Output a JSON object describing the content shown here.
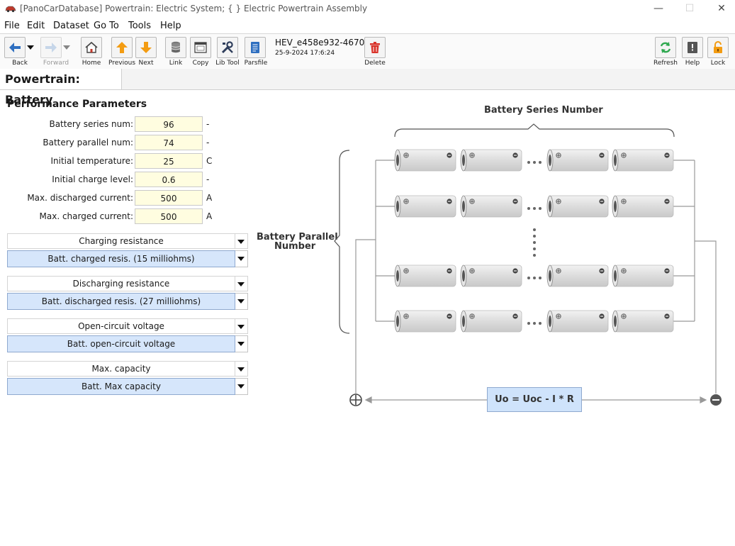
{
  "window": {
    "title": "[PanoCarDatabase] Powertrain: Electric System; {  } Electric Powertrain Assembly",
    "minimize_glyph": "—",
    "maximize_glyph": "☐",
    "close_glyph": "✕"
  },
  "menu": [
    "File",
    "Edit",
    "Dataset",
    "Go To",
    "Tools",
    "Help"
  ],
  "toolbar": {
    "back": "Back",
    "forward": "Forward",
    "home": "Home",
    "previous": "Previous",
    "next": "Next",
    "link": "Link",
    "copy": "Copy",
    "lib_tool": "Lib Tool",
    "parsfile": "Parsfile",
    "delete": "Delete",
    "refresh": "Refresh",
    "help": "Help",
    "lock": "Lock",
    "record_id": "HEV_e458e932-4670",
    "record_date": "25-9-2024 17:6:24"
  },
  "tab": {
    "title": "Powertrain: Battery"
  },
  "performance": {
    "title": "Performance Parameters",
    "params": [
      {
        "label": "Battery series num:",
        "value": "96",
        "unit": "-"
      },
      {
        "label": "Battery parallel num:",
        "value": "74",
        "unit": "-"
      },
      {
        "label": "Initial temperature:",
        "value": "25",
        "unit": "C"
      },
      {
        "label": "Initial charge level:",
        "value": "0.6",
        "unit": "-"
      },
      {
        "label": "Max. discharged current:",
        "value": "500",
        "unit": "A"
      },
      {
        "label": "Max. charged current:",
        "value": "500",
        "unit": "A"
      }
    ],
    "dropdowns": [
      {
        "header": "Charging resistance",
        "value": "Batt. charged resis. (15 milliohms)"
      },
      {
        "header": "Discharging resistance",
        "value": "Batt. discharged resis. (27 milliohms)"
      },
      {
        "header": "Open-circuit voltage",
        "value": "Batt. open-circuit voltage"
      },
      {
        "header": "Max. capacity",
        "value": "Batt. Max capacity"
      }
    ]
  },
  "diagram": {
    "series_label": "Battery Series Number",
    "parallel_label_1": "Battery Parallel",
    "parallel_label_2": "Number",
    "formula": "Uo = Uoc - I * R"
  },
  "colors": {
    "input_bg": "#fffde0",
    "selected_bg": "#d6e6fb",
    "formula_bg": "#cfe3fb",
    "arrow_orange": "#f39c12",
    "arrow_blue": "#2f6fc0",
    "delete_red": "#d9342b",
    "refresh_green": "#2ea84f"
  }
}
